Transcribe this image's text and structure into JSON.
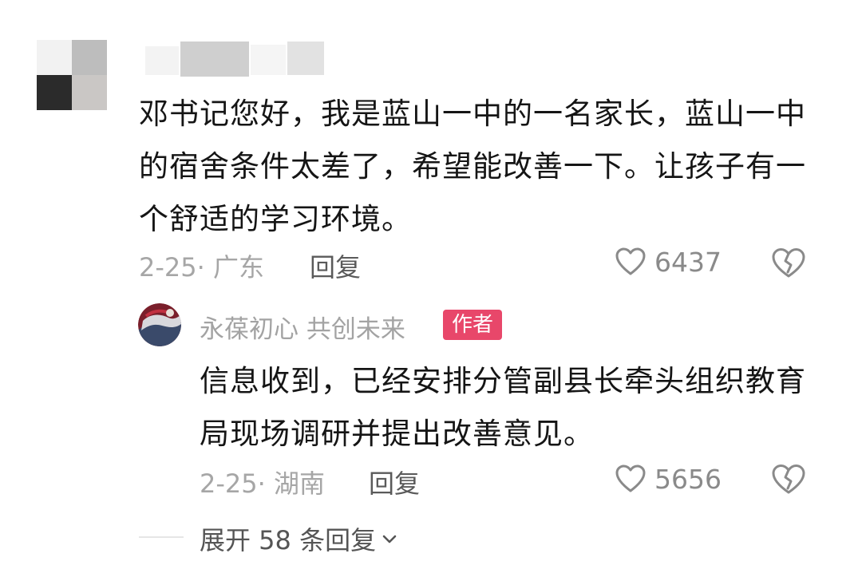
{
  "top_comment": {
    "text": "邓书记您好，我是蓝山一中的一名家长，蓝山一中的宿舍条件太差了，希望能改善一下。让孩子有一个舒适的学习环境。",
    "meta": "2-25· 广东",
    "reply_label": "回复",
    "like_count": "6437",
    "avatar_icon": "pixelated-avatar",
    "username_icon": "censored-username"
  },
  "reply": {
    "author_name": "永葆初心  共创未来",
    "author_badge": "作者",
    "badge_color": "#e8476a",
    "text": "信息收到，已经安排分管副县长牵头组织教育局现场调研并提出改善意见。",
    "meta": "2-25· 湖南",
    "reply_label": "回复",
    "like_count": "5656",
    "avatar_icon": "author-avatar"
  },
  "expand": {
    "label": "展开 58 条回复",
    "icon": "chevron-down-icon"
  }
}
